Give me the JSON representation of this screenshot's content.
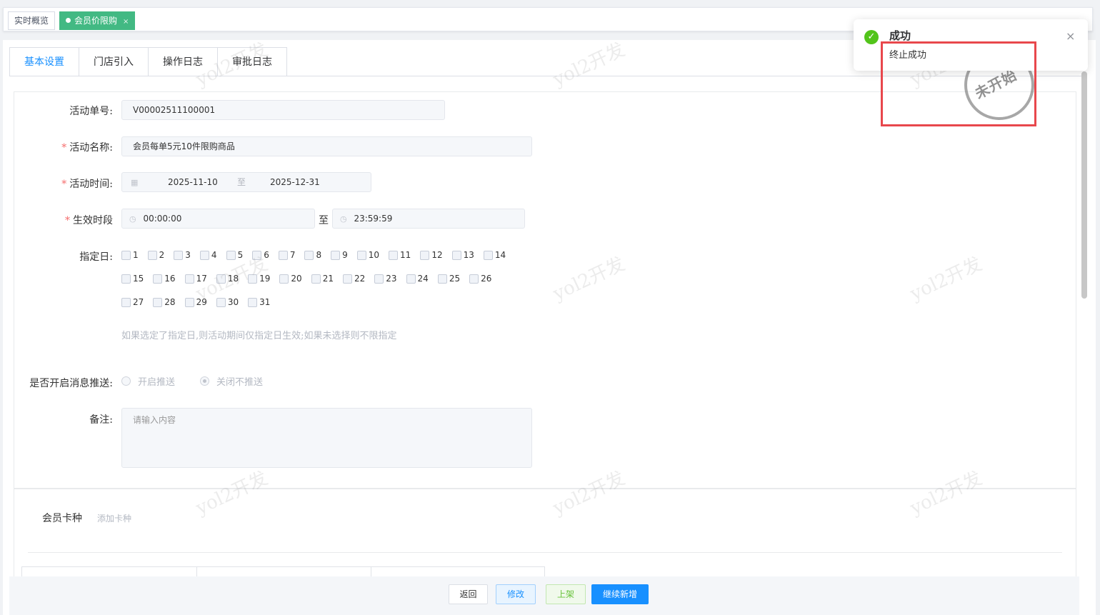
{
  "tags": [
    {
      "label": "实时概览",
      "active": false
    },
    {
      "label": "会员价限购",
      "active": true,
      "close": "×"
    }
  ],
  "tabs": [
    "基本设置",
    "门店引入",
    "操作日志",
    "审批日志"
  ],
  "form": {
    "order_no": {
      "label": "活动单号:",
      "value": "V00002511100001"
    },
    "name": {
      "label": "活动名称:",
      "required": "*",
      "value": "会员每单5元10件限购商品"
    },
    "time": {
      "label": "活动时间:",
      "required": "*",
      "start": "2025-11-10",
      "sep": "至",
      "end": "2025-12-31"
    },
    "period": {
      "label": "生效时段",
      "required": "*",
      "start": "00:00:00",
      "sep": "至",
      "end": "23:59:59"
    },
    "days": {
      "label": "指定日:",
      "row1": [
        "1",
        "2",
        "3",
        "4",
        "5",
        "6",
        "7",
        "8",
        "9",
        "10",
        "11",
        "12",
        "13",
        "14"
      ],
      "row2": [
        "15",
        "16",
        "17",
        "18",
        "19",
        "20",
        "21",
        "22",
        "23",
        "24",
        "25",
        "26"
      ],
      "row3": [
        "27",
        "28",
        "29",
        "30",
        "31"
      ],
      "hint": "如果选定了指定日,则活动期间仅指定日生效;如果未选择则不限指定"
    },
    "push": {
      "label": "是否开启消息推送:",
      "options": [
        "开启推送",
        "关闭不推送"
      ],
      "selected": "关闭不推送"
    },
    "remark": {
      "label": "备注:",
      "placeholder": "请输入内容"
    }
  },
  "card_section": {
    "title": "会员卡种",
    "add_link": "添加卡种"
  },
  "stamp": "未开始",
  "footer": {
    "back": "返回",
    "edit": "修改",
    "shelve": "上架",
    "continue_add": "继续新增"
  },
  "notification": {
    "title": "成功",
    "message": "终止成功",
    "close": "×"
  },
  "watermark": "yol2开发"
}
